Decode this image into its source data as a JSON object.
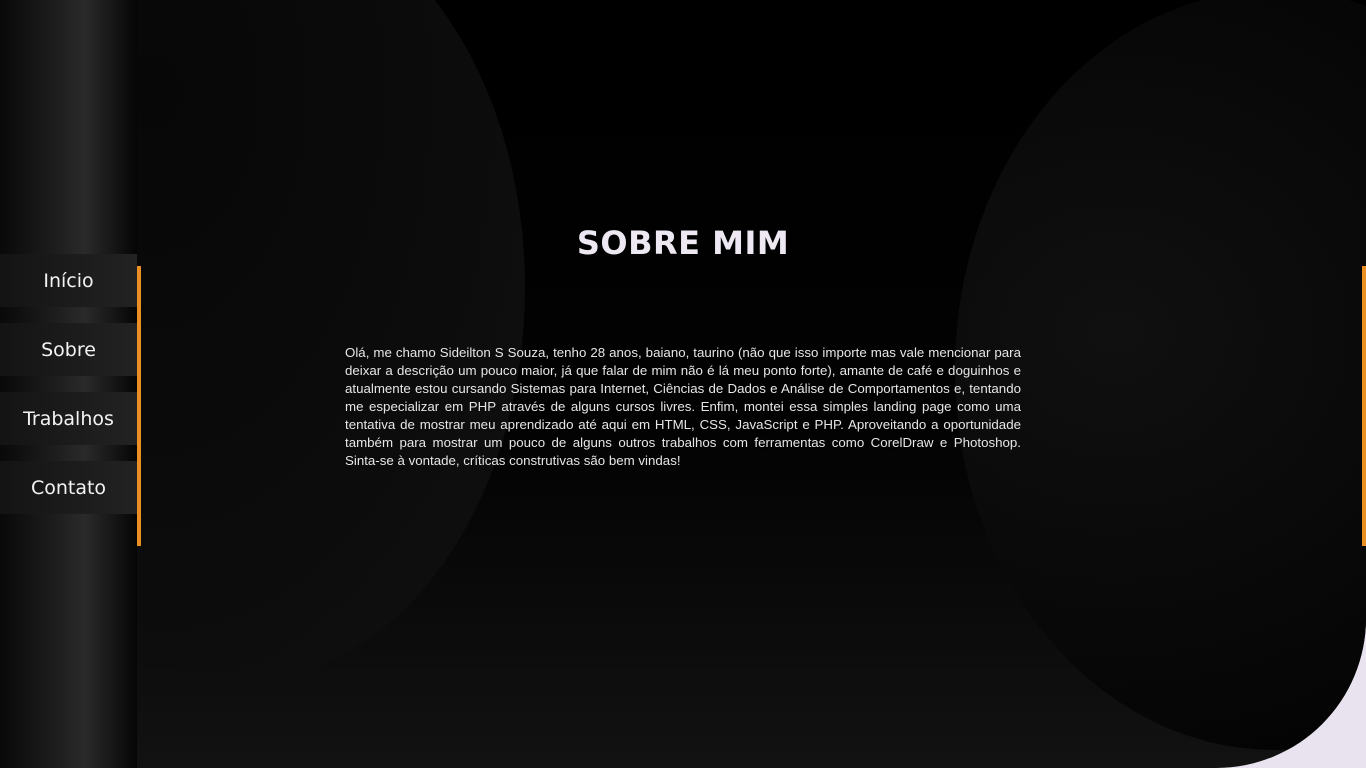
{
  "navigation": {
    "items": [
      {
        "label": "Início"
      },
      {
        "label": "Sobre"
      },
      {
        "label": "Trabalhos"
      },
      {
        "label": "Contato"
      }
    ]
  },
  "section": {
    "title": "SOBRE MIM",
    "body": "Olá, me chamo Sideilton S Souza, tenho 28 anos, baiano, taurino (não que isso importe mas vale mencionar para deixar a descrição um pouco maior, já que falar de mim não é lá meu ponto forte), amante de café e doguinhos e atualmente estou cursando Sistemas para Internet, Ciências de Dados e Análise de Comportamentos e, tentando me especializar em PHP através de alguns cursos livres. Enfim, montei essa simples landing page como uma tentativa de mostrar meu aprendizado até aqui em HTML, CSS, JavaScript e PHP. Aproveitando a oportunidade também para mostrar um pouco de alguns outros trabalhos com ferramentas como CorelDraw e Photoshop. Sinta-se à vontade, críticas construtivas são bem vindas!"
  },
  "colors": {
    "accent": "#ec8f23",
    "background": "#000000",
    "title_text": "#eee8f3",
    "corner_light": "#e9e3ef"
  }
}
